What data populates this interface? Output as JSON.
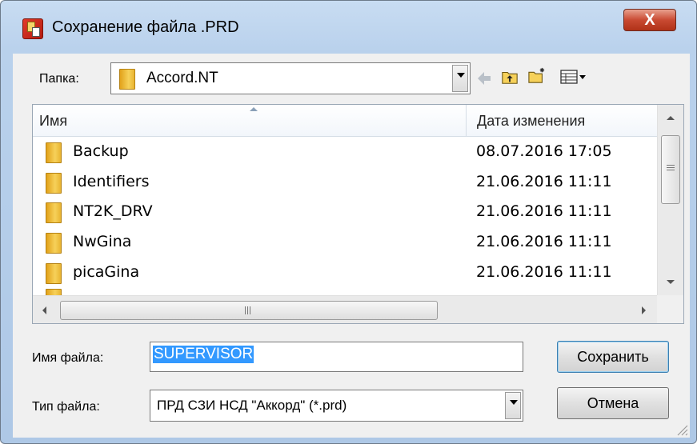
{
  "window": {
    "title": "Сохранение файла .PRD",
    "close_label": "X"
  },
  "folder_bar": {
    "label": "Папка:",
    "current": "Accord.NT"
  },
  "list": {
    "columns": [
      "Имя",
      "Дата изменения"
    ],
    "rows": [
      {
        "name": "Backup",
        "date": "08.07.2016 17:05"
      },
      {
        "name": "Identifiers",
        "date": "21.06.2016 11:11"
      },
      {
        "name": "NT2K_DRV",
        "date": "21.06.2016 11:11"
      },
      {
        "name": "NwGina",
        "date": "21.06.2016 11:11"
      },
      {
        "name": "picaGina",
        "date": "21.06.2016 11:11"
      }
    ]
  },
  "filename": {
    "label": "Имя файла:",
    "value": "SUPERVISOR"
  },
  "filetype": {
    "label": "Тип файла:",
    "value": "ПРД СЗИ НСД \"Аккорд\" (*.prd)"
  },
  "buttons": {
    "save": "Сохранить",
    "cancel": "Отмена"
  },
  "icons": [
    "back-arrow-icon",
    "up-folder-icon",
    "new-folder-icon",
    "view-menu-icon",
    "folder-icon",
    "app-icon"
  ]
}
